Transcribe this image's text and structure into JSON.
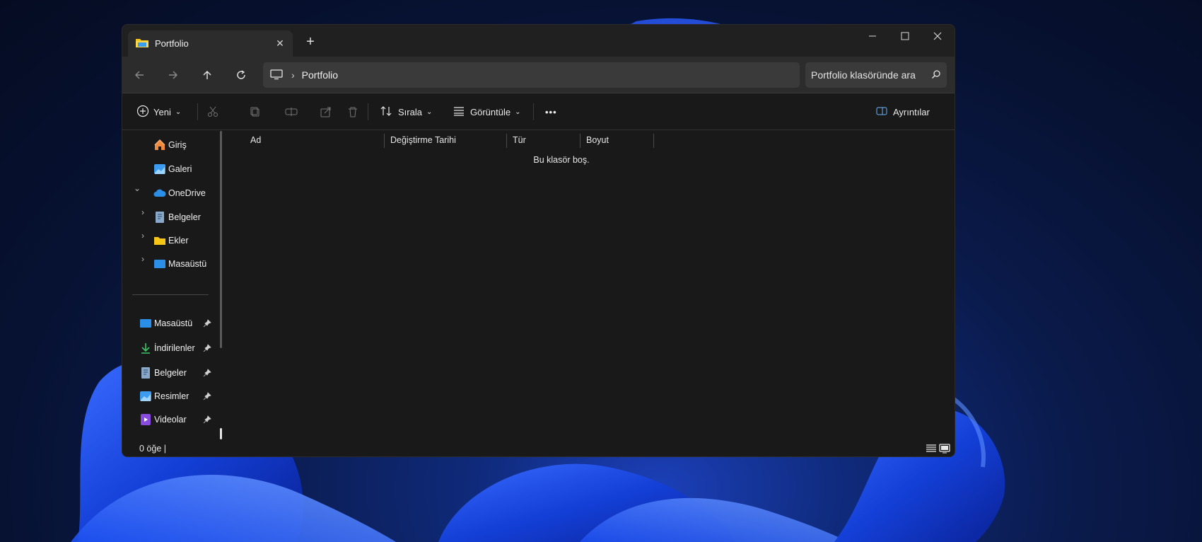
{
  "window": {
    "tab_title": "Portfolio",
    "new_tab": "+",
    "close_tab": "✕"
  },
  "navbar": {
    "address_path": "Portfolio",
    "search_placeholder": "Portfolio klasöründe ara"
  },
  "toolbar": {
    "new_label": "Yeni",
    "sort_label": "Sırala",
    "view_label": "Görüntüle",
    "more_label": "•••",
    "details_label": "Ayrıntılar"
  },
  "sidebar": {
    "top_items": [
      {
        "label": "Giriş",
        "icon": "home-icon"
      },
      {
        "label": "Galeri",
        "icon": "gallery-icon"
      },
      {
        "label": "OneDrive",
        "icon": "cloud-icon"
      },
      {
        "label": "Belgeler",
        "icon": "documents-icon"
      },
      {
        "label": "Ekler",
        "icon": "folder-icon"
      },
      {
        "label": "Masaüstü",
        "icon": "desktop-icon"
      }
    ],
    "pinned_items": [
      {
        "label": "Masaüstü",
        "icon": "desktop-icon"
      },
      {
        "label": "İndirilenler",
        "icon": "download-icon"
      },
      {
        "label": "Belgeler",
        "icon": "documents-icon"
      },
      {
        "label": "Resimler",
        "icon": "pictures-icon"
      },
      {
        "label": "Videolar",
        "icon": "videos-icon"
      }
    ]
  },
  "content": {
    "columns": [
      "Ad",
      "Değiştirme Tarihi",
      "Tür",
      "Boyut"
    ],
    "empty_message": "Bu klasör boş."
  },
  "status": {
    "item_count": "0 öğe |"
  },
  "colors": {
    "accent_folder": "#f5c518",
    "accent_blue": "#3b9cf0",
    "window_bg": "#191919"
  }
}
